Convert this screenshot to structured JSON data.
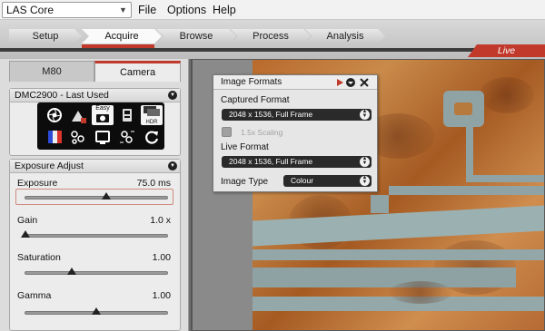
{
  "menubar": {
    "app_select_value": "LAS Core",
    "menus": [
      "File",
      "Options",
      "Help"
    ]
  },
  "workflow_tabs": [
    {
      "label": "Setup",
      "active": false
    },
    {
      "label": "Acquire",
      "active": true
    },
    {
      "label": "Browse",
      "active": false
    },
    {
      "label": "Process",
      "active": false
    },
    {
      "label": "Analysis",
      "active": false
    }
  ],
  "live_label": "Live",
  "panel_tabs": [
    {
      "label": "M80",
      "active": false
    },
    {
      "label": "Camera",
      "active": true
    }
  ],
  "camera_group": {
    "title": "DMC2900 - Last Used",
    "tool_buttons": [
      "aperture-icon",
      "exposure-icon",
      "easy-icon",
      "camera-settings-icon",
      "hdr-icon",
      "color-bars-icon",
      "effects-icon",
      "screen-icon",
      "adjust-icon",
      "refresh-icon"
    ],
    "easy_label": "Easy",
    "hdr_label": "HDR"
  },
  "exposure_group": {
    "title": "Exposure Adjust",
    "sliders": [
      {
        "label": "Exposure",
        "value": "75.0 ms",
        "position": 0.57
      },
      {
        "label": "Gain",
        "value": "1.0 x",
        "position": 0.0
      },
      {
        "label": "Saturation",
        "value": "1.00",
        "position": 0.33
      },
      {
        "label": "Gamma",
        "value": "1.00",
        "position": 0.5
      }
    ]
  },
  "image_formats_dialog": {
    "title": "Image Formats",
    "captured_label": "Captured Format",
    "captured_value": "2048 x 1536, Full Frame",
    "scaling_label": "1.5x Scaling",
    "live_label": "Live Format",
    "live_value": "2048 x 1536, Full Frame",
    "image_type_label": "Image Type",
    "image_type_value": "Colour"
  }
}
